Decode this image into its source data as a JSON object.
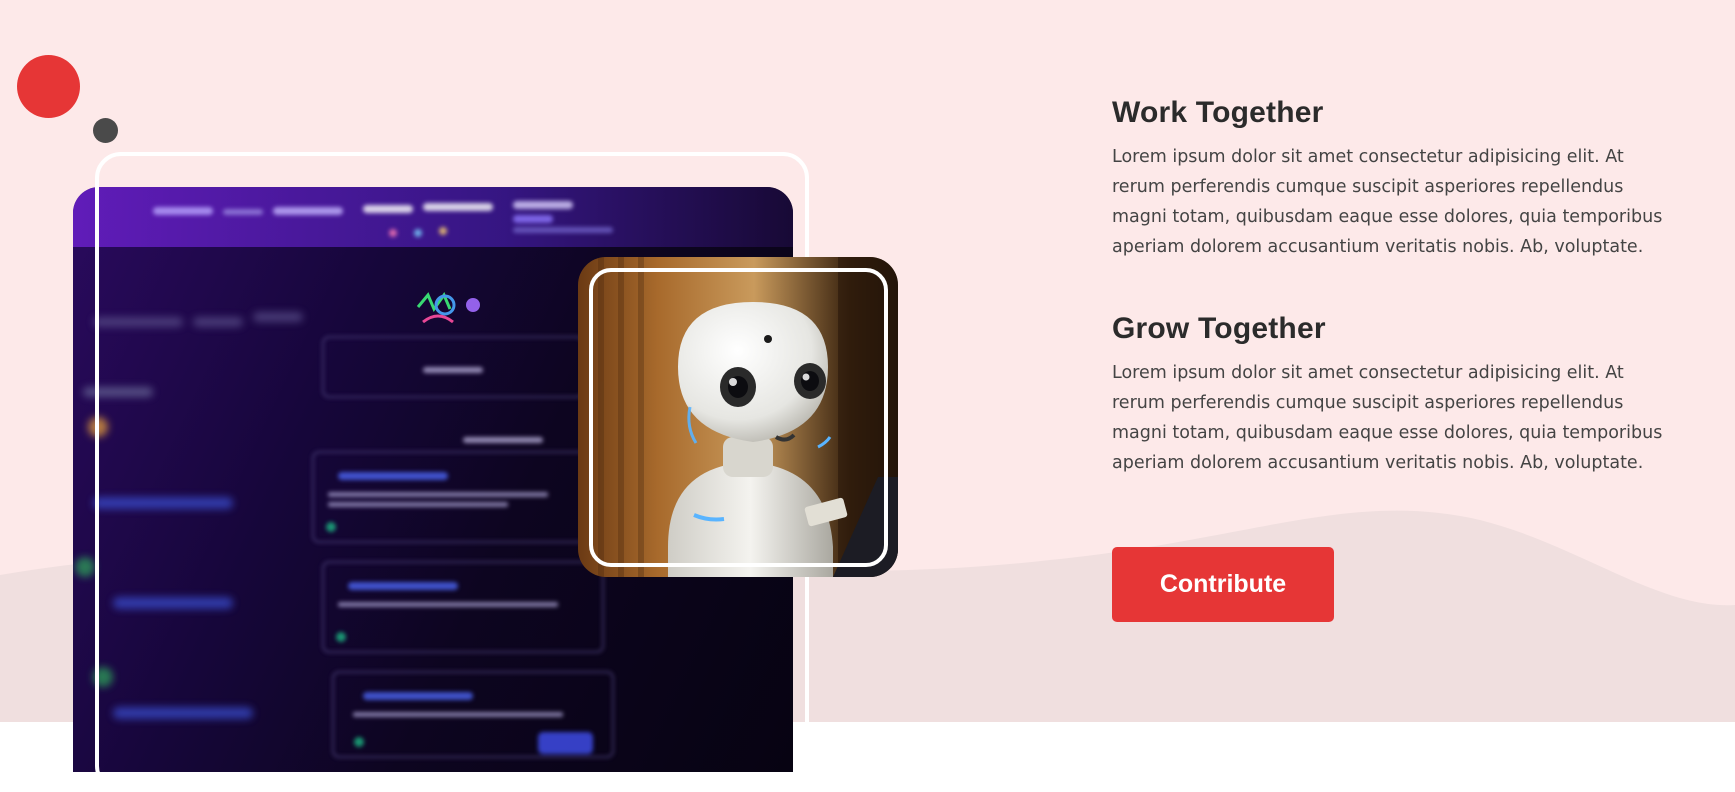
{
  "sections": [
    {
      "title": "Work Together",
      "body": "Lorem ipsum dolor sit amet consectetur adipisicing elit. At rerum perferendis cumque suscipit asperiores repellendus magni totam, quibusdam eaque esse dolores, quia temporibus aperiam dolorem accusantium veritatis nobis. Ab, voluptate."
    },
    {
      "title": "Grow Together",
      "body": "Lorem ipsum dolor sit amet consectetur adipisicing elit. At rerum perferendis cumque suscipit asperiores repellendus magni totam, quibusdam eaque esse dolores, quia temporibus aperiam dolorem accusantium veritatis nobis. Ab, voluptate."
    }
  ],
  "cta": {
    "label": "Contribute"
  },
  "colors": {
    "accent": "#e63636",
    "hero_background": "#fde9e9",
    "wave": "#f0dfdf",
    "dot_dark": "#4a4a4a"
  },
  "images": {
    "main": "laptop-screen-photo",
    "secondary": "robot-photo"
  }
}
